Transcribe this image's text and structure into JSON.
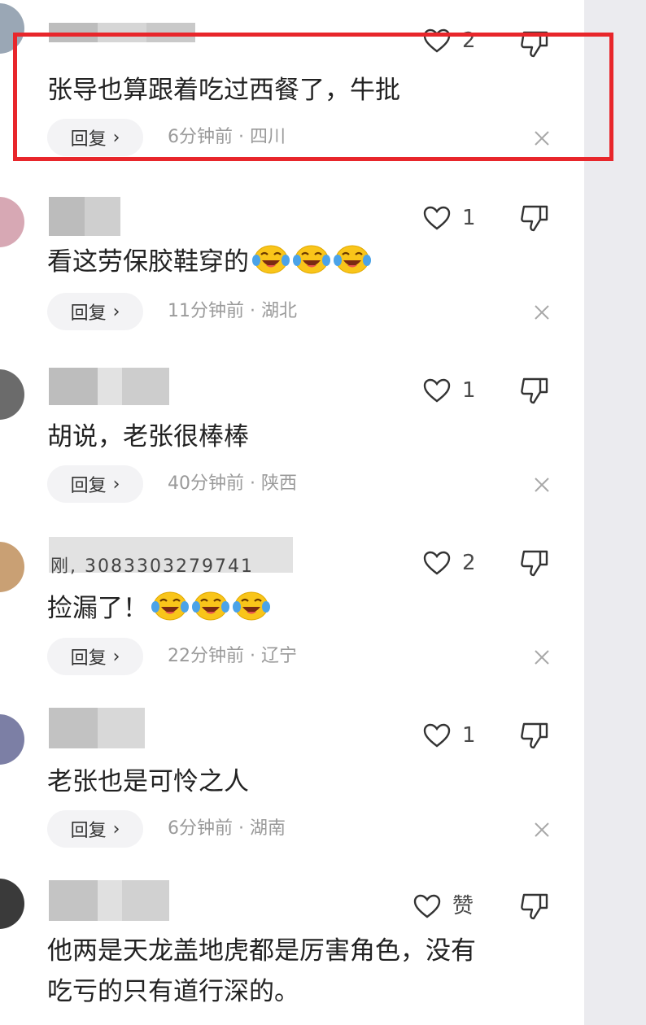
{
  "comments": [
    {
      "likes": "2",
      "text": "张导也算跟着吃过西餐了，牛批",
      "emoji_count": 0,
      "reply": "回复",
      "time": "6分钟前",
      "sep": " · ",
      "region": "四川"
    },
    {
      "likes": "1",
      "text": "看这劳保胶鞋穿的",
      "emoji_count": 3,
      "reply": "回复",
      "time": "11分钟前",
      "sep": " · ",
      "region": "湖北"
    },
    {
      "likes": "1",
      "text": "胡说，老张很棒棒",
      "emoji_count": 0,
      "reply": "回复",
      "time": "40分钟前",
      "sep": " · ",
      "region": "陕西"
    },
    {
      "likes": "2",
      "text": "捡漏了！",
      "emoji_count": 3,
      "reply": "回复",
      "time": "22分钟前",
      "sep": " · ",
      "region": "辽宁"
    },
    {
      "likes": "1",
      "text": "老张也是可怜之人",
      "emoji_count": 0,
      "reply": "回复",
      "time": "6分钟前",
      "sep": " · ",
      "region": "湖南"
    },
    {
      "likes": "赞",
      "text": "他两是天龙盖地虎都是厉害角色，没有",
      "text2": "吃亏的只有道行深的。",
      "emoji_count": 0
    }
  ],
  "partial_username": "刚, 3083303279741",
  "colors": {
    "highlight": "#e8262b",
    "text": "#222222",
    "meta": "#9a9a9a",
    "reply_bg": "#f3f3f5",
    "page_bg": "#ebebef"
  },
  "icons": [
    "heart-outline-icon",
    "thumbs-down-icon",
    "close-icon",
    "laughing-crying-emoji-icon",
    "chevron-right-icon"
  ]
}
